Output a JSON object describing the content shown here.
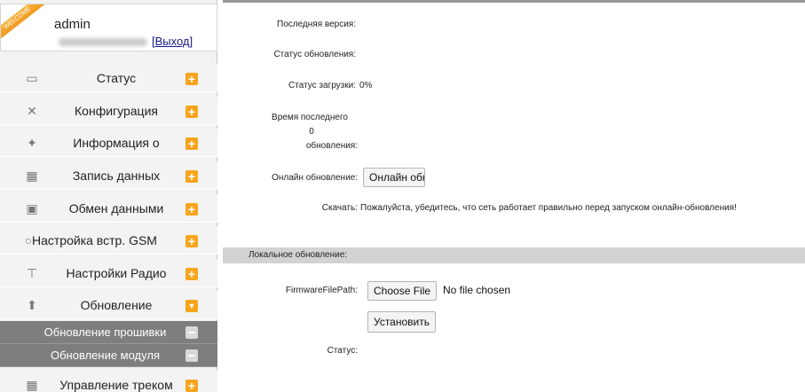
{
  "user": {
    "badge": "WELCOME",
    "username": "admin",
    "logout_label": "[Выход]"
  },
  "menu": {
    "items": [
      {
        "label": "Статус",
        "icon": "monitor-icon"
      },
      {
        "label": "Конфигурация",
        "icon": "tools-icon"
      },
      {
        "label": "Информация о",
        "icon": "satellite-icon"
      },
      {
        "label": "Запись данных",
        "icon": "calendar-icon"
      },
      {
        "label": "Обмен данными",
        "icon": "network-icon"
      },
      {
        "label": "Настройка встр. GSM",
        "icon": "globe-icon"
      },
      {
        "label": "Настройки Радио",
        "icon": "antenna-icon"
      },
      {
        "label": "Обновление",
        "icon": "upload-icon"
      },
      {
        "label": "Управление треком",
        "icon": "calendar-icon"
      }
    ],
    "sub_items": [
      {
        "label": "Обновление прошивки"
      },
      {
        "label": "Обновление модуля"
      }
    ],
    "accent_color": "#f6a51c"
  },
  "update": {
    "latest_version_label": "Последняя версия:",
    "latest_version_value": "",
    "update_status_label": "Статус обновления:",
    "update_status_value": "",
    "download_status_label": "Статус загрузки:",
    "download_status_value": "0%",
    "last_update_label_1": "Время последнего",
    "last_update_label_2": "обновления:",
    "last_update_value": "0",
    "online_update_label": "Онлайн обновление:",
    "online_update_button": "Онлайн обновление",
    "download_label": "Скачать:",
    "download_note": "Пожалуйста, убедитесь, что сеть работает правильно перед запуском онлайн-обновления!"
  },
  "local_update": {
    "section_title": "Локальное обновление:",
    "firmware_path_label": "FirmwareFilePath:",
    "choose_file_button": "Choose File",
    "file_status": "No file chosen",
    "install_button": "Установить",
    "status_label": "Статус:",
    "status_value": ""
  }
}
